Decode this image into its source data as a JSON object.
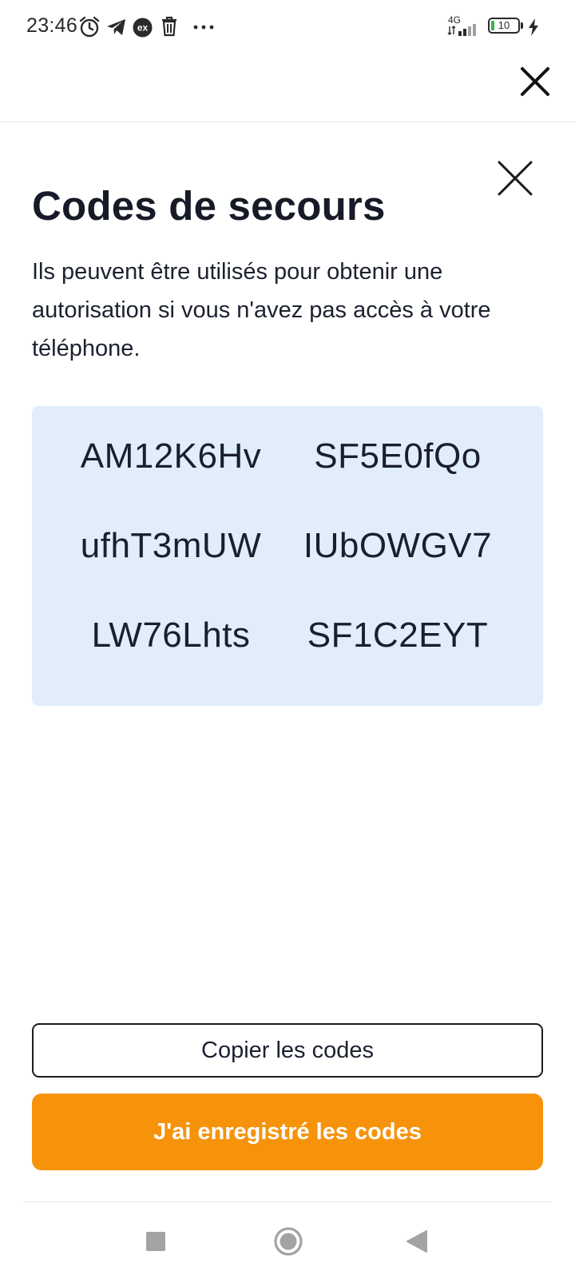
{
  "status_bar": {
    "time": "23:46",
    "network": "4G",
    "battery": "10",
    "icons": [
      "alarm-icon",
      "telegram-icon",
      "ex-app-icon",
      "trash-icon",
      "more-dots-icon",
      "signal-icon",
      "battery-icon",
      "charging-icon"
    ]
  },
  "dialog": {
    "title": "Codes de secours",
    "description": "Ils peuvent être utilisés pour obtenir une autorisation si vous n'avez pas accès à votre téléphone.",
    "codes": [
      "AM12K6Hv",
      "SF5E0fQo",
      "ufhT3mUW",
      "IUbOWGV7",
      "LW76Lhts",
      "SF1C2EYT"
    ],
    "copy_button": "Copier les codes",
    "confirm_button": "J'ai enregistré les codes"
  },
  "colors": {
    "accent": "#f7930a",
    "codes_background": "#e1edfb",
    "text": "#1a1f2b"
  },
  "nav_bar": {
    "icons": [
      "recents-square-icon",
      "home-circle-icon",
      "back-triangle-icon"
    ]
  }
}
